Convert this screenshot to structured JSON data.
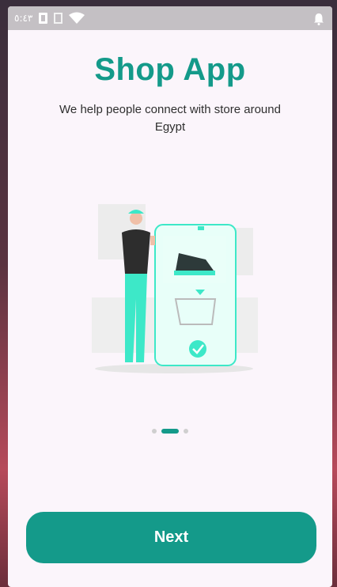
{
  "statusbar": {
    "time": "٥:٤٣",
    "icons": [
      "sim-card-icon",
      "no-sim-icon",
      "wifi-icon",
      "notification-bell-icon"
    ]
  },
  "onboarding": {
    "title": "Shop App",
    "subtitle": "We help people connect with store around Egypt",
    "page_indicator": {
      "total": 3,
      "current": 2
    },
    "illustration": "person-shopping-on-phone-illustration"
  },
  "actions": {
    "next_label": "Next"
  },
  "colors": {
    "accent": "#149a8a",
    "mint": "#3de8c8",
    "background": "#fbf5fb",
    "statusbar": "#c4c0c4"
  }
}
